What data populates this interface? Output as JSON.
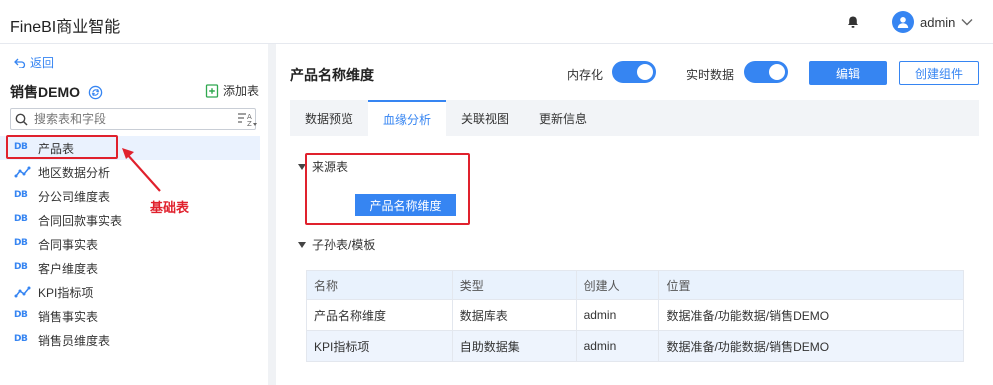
{
  "app": {
    "title": "FineBI商业智能",
    "user": "admin"
  },
  "sidebar": {
    "back_label": "返回",
    "package_title": "销售DEMO",
    "add_table_label": "添加表",
    "search_placeholder": "搜索表和字段",
    "db_icon_text": "DB",
    "items": [
      {
        "label": "产品表",
        "icon": "db-icon",
        "selected": true
      },
      {
        "label": "地区数据分析",
        "icon": "self-dataset-icon"
      },
      {
        "label": "分公司维度表",
        "icon": "db-icon"
      },
      {
        "label": "合同回款事实表",
        "icon": "db-icon"
      },
      {
        "label": "合同事实表",
        "icon": "db-icon"
      },
      {
        "label": "客户维度表",
        "icon": "db-icon"
      },
      {
        "label": "KPI指标项",
        "icon": "self-dataset-icon"
      },
      {
        "label": "销售事实表",
        "icon": "db-icon"
      },
      {
        "label": "销售员维度表",
        "icon": "db-icon"
      }
    ]
  },
  "annotation": {
    "label": "基础表",
    "color": "#e0212d"
  },
  "main": {
    "title": "产品名称维度",
    "memory_label": "内存化",
    "realtime_label": "实时数据",
    "memory_on": true,
    "realtime_on": true,
    "edit_label": "编辑",
    "create_component_label": "创建组件",
    "tabs": [
      "数据预览",
      "血缘分析",
      "关联视图",
      "更新信息"
    ],
    "active_tab": 1,
    "source_section": "来源表",
    "source_node": "产品名称维度",
    "child_section": "子孙表/模板",
    "table": {
      "headers": [
        "名称",
        "类型",
        "创建人",
        "位置"
      ],
      "rows": [
        [
          "产品名称维度",
          "数据库表",
          "admin",
          "数据准备/功能数据/销售DEMO"
        ],
        [
          "KPI指标项",
          "自助数据集",
          "admin",
          "数据准备/功能数据/销售DEMO"
        ]
      ]
    }
  },
  "colors": {
    "accent": "#3685f2",
    "highlight": "#e0212d"
  }
}
